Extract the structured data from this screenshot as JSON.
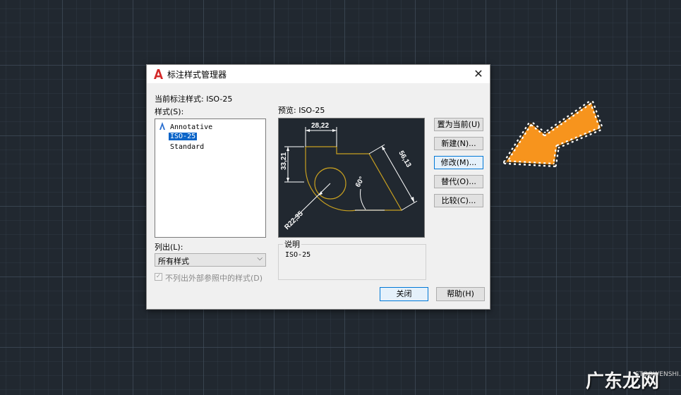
{
  "dialog": {
    "title": "标注样式管理器",
    "current_style_label": "当前标注样式: ISO-25",
    "styles_label": "样式(S):",
    "styles": [
      {
        "name": "Annotative",
        "annotative": true,
        "selected": false
      },
      {
        "name": "ISO-25",
        "annotative": false,
        "selected": true
      },
      {
        "name": "Standard",
        "annotative": false,
        "selected": false
      }
    ],
    "list_label": "列出(L):",
    "list_value": "所有样式",
    "exclude_xref_label": "不列出外部参照中的样式(D)",
    "exclude_xref_checked": true,
    "preview_label": "预览: ISO-25",
    "preview": {
      "dim_top": "28,22",
      "dim_left": "33,21",
      "dim_diag": "56,13",
      "dim_angle": "60°",
      "dim_radius": "R22,35"
    },
    "description_label": "说明",
    "description_text": "ISO-25",
    "buttons": {
      "set_current": "置为当前(U)",
      "new": "新建(N)...",
      "modify": "修改(M)...",
      "override": "替代(O)...",
      "compare": "比较(C)...",
      "close": "关闭",
      "help": "帮助(H)"
    }
  },
  "watermark": {
    "text": "广东龙网",
    "small": "STOOWENSHI.COM"
  },
  "colors": {
    "accent_arrow": "#f7941d",
    "preview_line": "#c8a020",
    "selection": "#0a64c8"
  }
}
